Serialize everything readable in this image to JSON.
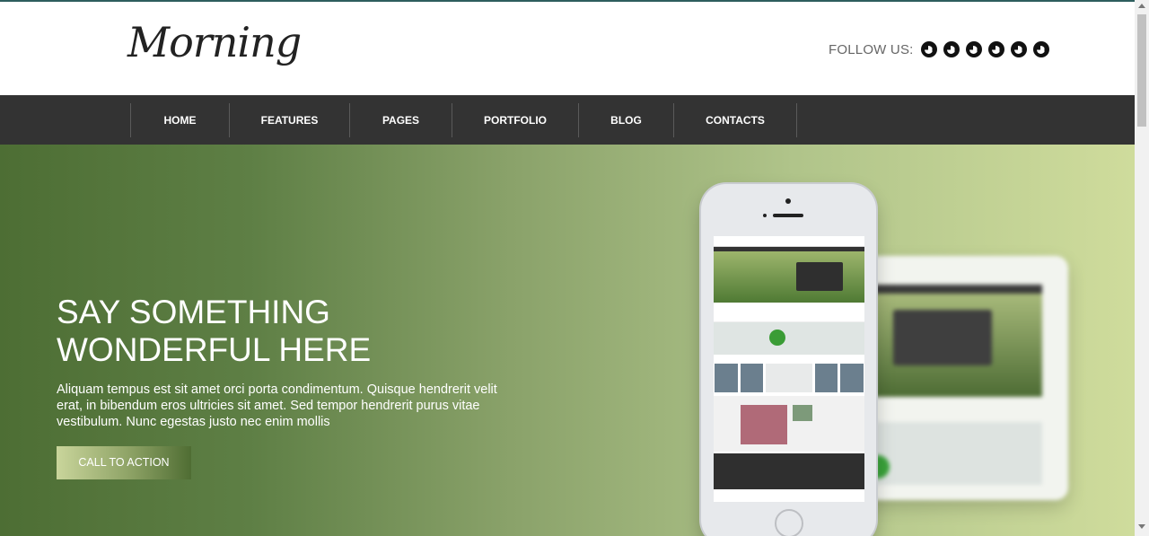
{
  "header": {
    "logo": "Morning",
    "follow_label": "FOLLOW US:",
    "social_icons": [
      "social-icon-1",
      "social-icon-2",
      "social-icon-3",
      "social-icon-4",
      "social-icon-5",
      "social-icon-6"
    ]
  },
  "nav": {
    "items": [
      {
        "label": "HOME"
      },
      {
        "label": "FEATURES"
      },
      {
        "label": "PAGES"
      },
      {
        "label": "PORTFOLIO"
      },
      {
        "label": "BLOG"
      },
      {
        "label": "CONTACTS"
      }
    ]
  },
  "hero": {
    "title_line1": "SAY SOMETHING",
    "title_line2": "WONDERFUL HERE",
    "text": "Aliquam tempus est sit amet orci porta condimentum. Quisque hendrerit velit erat, in bibendum eros ultricies sit amet. Sed tempor hendrerit purus vitae vestibulum. Nunc egestas justo nec enim mollis",
    "cta_label": "CALL TO ACTION"
  },
  "colors": {
    "nav_bg": "#333333",
    "hero_start": "#4d6e34",
    "hero_end": "#cfdc9c"
  }
}
